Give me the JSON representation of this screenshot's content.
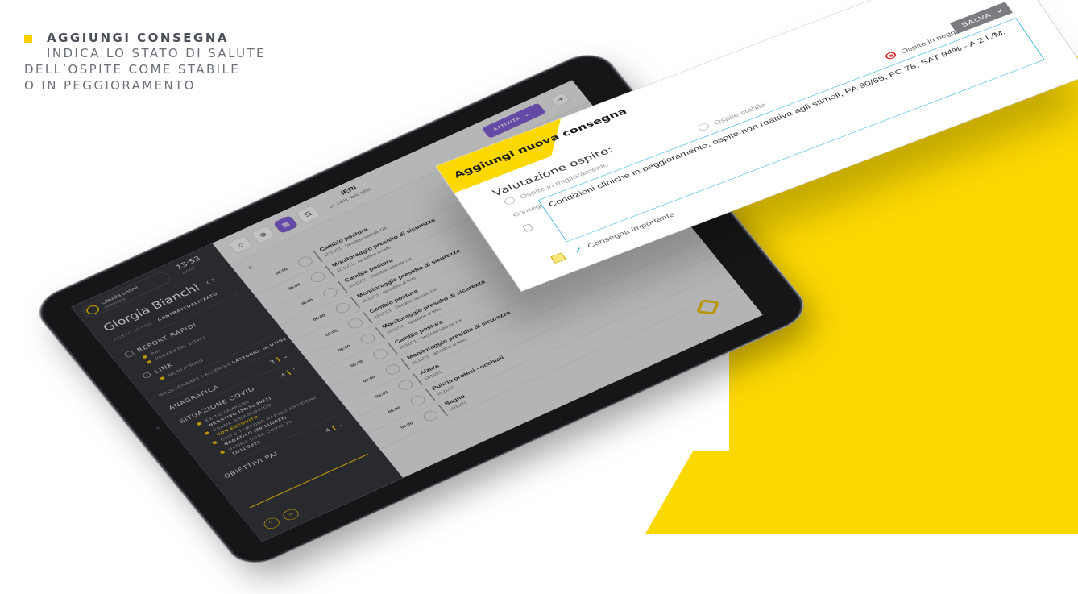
{
  "caption": {
    "title": "AGGIUNGI CONSEGNA",
    "line1": "INDICA LO STATO DI SALUTE",
    "line2": "DELL’OSPITE COME STABILE",
    "line3": "O IN PEGGIORAMENTO"
  },
  "colors": {
    "accent_yellow": "#fbd800",
    "accent_purple": "#7b59d6",
    "play_green": "#24b34a",
    "stop_red": "#e0302f"
  },
  "sidebar": {
    "user_name": "Claudia Leone",
    "user_role": "Infermiera",
    "clock": "13:53",
    "clock_date": "lunedì",
    "patient_name": "Giorgia Bianchi",
    "patient_meta": "POSTO LETTO",
    "patient_meta_value": "CONTRATTUALIZZATO",
    "report_title": "REPORT RAPIDI",
    "report_items": [
      "PAI",
      "PARAMETRI VITALI"
    ],
    "link_title": "LINK",
    "link_items": [
      "MONITORING"
    ],
    "allergies_label": "INTOLLERANZE / ALLERGIE",
    "allergies_value": "LATTOSIO, GLUTINE",
    "anagrafica": "ANAGRAFICA",
    "anagrafica_count": "3",
    "covid_title": "SITUAZIONE COVID",
    "covid_count": "4",
    "covid_items": [
      "ESITO TAMPONE",
      "NEGATIVO (30/11/2021)",
      "ESAME SIEROLOGICO",
      "NON ESEGUITO",
      "ESITO TAMPONE RAPIDO ANTIGENE",
      "NEGATIVO (30/11/2021)",
      "ULTIMA DOSE COVID 19",
      "11/11/2021"
    ],
    "obiettivi": "OBIETTIVI PAI",
    "obiettivi_count": "4"
  },
  "topbar": {
    "day_title": "IERI",
    "day_sub_a": "ILL 14/11",
    "day_sub_b": "DAL 14/11",
    "activities_button": "ATTIVITÀ"
  },
  "rows": [
    {
      "hour": "06:00",
      "title": "Cambio postura",
      "sub": "11/11/21 · Decubito laterale DX"
    },
    {
      "hour": "06:00",
      "title": "Monitoraggio presidio di sicurezza",
      "sub": "11/11/21 · spondine al letto"
    },
    {
      "hour": "06:00",
      "title": "Cambio postura",
      "sub": "11/11/21 · Decubito laterale DX"
    },
    {
      "hour": "06:00",
      "title": "Monitoraggio presidio di sicurezza",
      "sub": "11/11/21 · spondine al letto"
    },
    {
      "hour": "06:00",
      "title": "Cambio postura",
      "sub": "11/11/21 · Decubito laterale DX"
    },
    {
      "hour": "06:00",
      "title": "Monitoraggio presidio di sicurezza",
      "sub": "11/11/21 · spondine al letto"
    },
    {
      "hour": "06:00",
      "title": "Cambio postura",
      "sub": "11/11/21 · Decubito laterale DX"
    },
    {
      "hour": "06:00",
      "title": "Monitoraggio presidio di sicurezza",
      "sub": "11/11/21 · spondine al letto"
    },
    {
      "hour": "06:00",
      "title": "Alzata",
      "sub": "11/11/21"
    },
    {
      "hour": "06:00",
      "title": "Pulizia protesi - occhiali",
      "sub": "11/11/21"
    },
    {
      "hour": "06:00",
      "title": "Bagno",
      "sub": "11/11/21"
    }
  ],
  "modal": {
    "title": "Aggiungi nuova consegna",
    "valutazione_label": "Valutazione ospite:",
    "opt_migliora": "Ospite in miglioramento",
    "opt_stabile": "Ospite stabile",
    "opt_peggiora": "Ospite in peggioramento",
    "selected_option": "Ospite in peggioramento",
    "consegna_label": "Consegna:",
    "consegna_text": "Condizioni cliniche in peggioramento, ospite non reattiva agli stimoli, PA 90/65, FC 78, SAT 94% - A 2 L/M.",
    "important_label": "Consegna importante",
    "save_label": "SALVA"
  }
}
